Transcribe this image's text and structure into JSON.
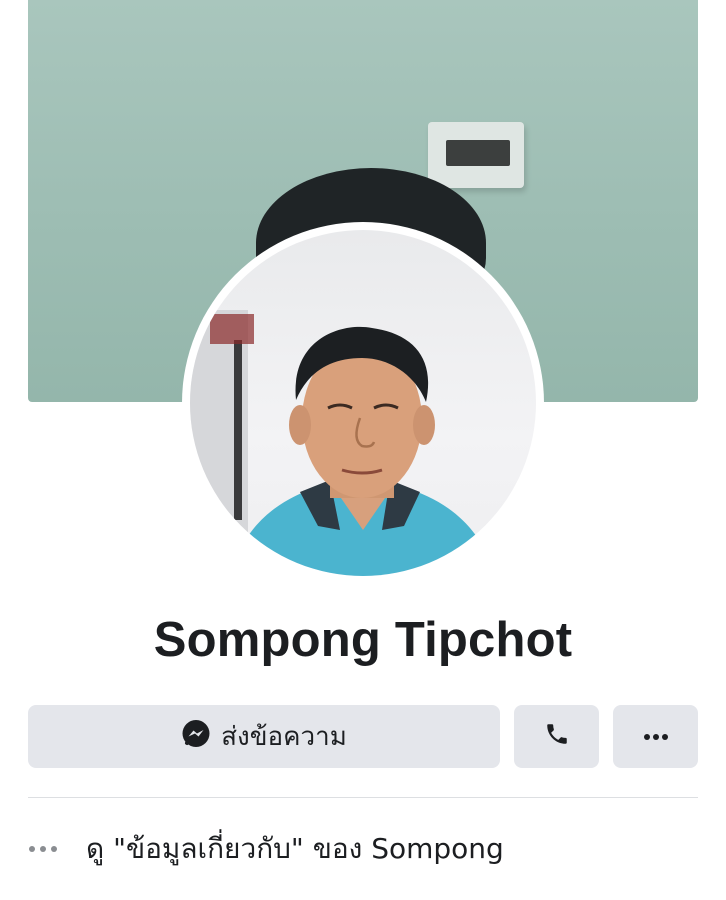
{
  "profile": {
    "name": "Sompong Tipchot"
  },
  "actions": {
    "message_label": "ส่งข้อความ",
    "message_icon": "messenger-icon",
    "call_icon": "phone-icon",
    "more_icon": "more-dots-icon"
  },
  "about": {
    "icon": "more-dots-icon",
    "text": "ดู \"ข้อมูลเกี่ยวกับ\" ของ Sompong"
  },
  "colors": {
    "button_bg": "#e4e6eb",
    "text": "#1c1e21",
    "divider": "#dddfe2"
  }
}
